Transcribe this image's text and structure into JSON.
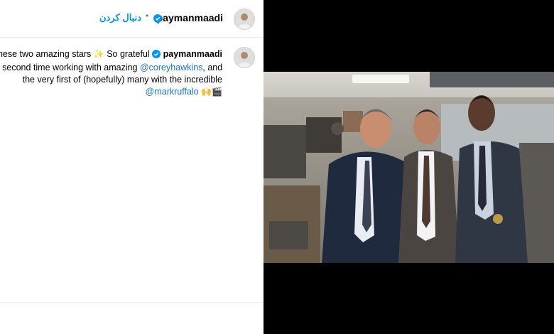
{
  "header": {
    "username": "paymanmaadi",
    "separator": "•",
    "follow_label": "دنبال کردن"
  },
  "caption": {
    "line1_prefix": "o these two amazing stars",
    "line1_emoji": "✨",
    "line1_mid": " So grateful ",
    "mention_self": "paymanmaadi",
    "line2_prefix": "my second time working with amazing ",
    "mention_corey": "@coreyhawkins",
    "line2_suffix": ", and",
    "line3": "the very first of (hopefully) many with the incredible",
    "mention_mark": "@markruffalo",
    "line4_emoji": "🙌🎬"
  },
  "colors": {
    "accent": "#0095f6",
    "mention": "#1e73be",
    "verified": "#0095f6",
    "media_bg": "#000000"
  },
  "icons": {
    "verified": "verified-badge-icon",
    "avatar": "profile-avatar"
  }
}
